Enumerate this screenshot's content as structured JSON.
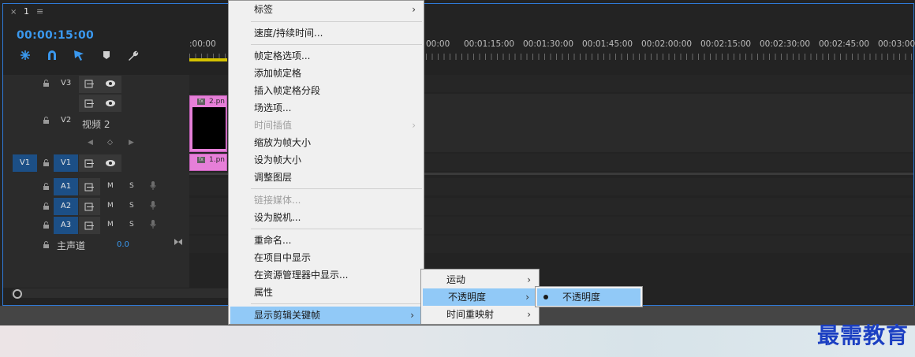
{
  "sequence": {
    "tab_label": "1",
    "close_glyph": "×",
    "menu_glyph": "≡",
    "timecode": "00:00:15:00"
  },
  "toolbar_icons": [
    "snap-icon",
    "magnet-icon",
    "linked-selection-icon",
    "marker-icon",
    "wrench-icon"
  ],
  "ruler": {
    "labels": [
      ":00:00",
      "00:00",
      "00:01:15:00",
      "00:01:30:00",
      "00:01:45:00",
      "00:02:00:00",
      "00:02:15:00",
      "00:02:30:00",
      "00:02:45:00",
      "00:03:00:0"
    ]
  },
  "tracks": {
    "v3": {
      "name": "V3"
    },
    "v2": {
      "name": "V2",
      "title": "视频 2"
    },
    "v1": {
      "source": "V1",
      "name": "V1"
    },
    "a1": {
      "name": "A1",
      "m": "M",
      "s": "S"
    },
    "a2": {
      "name": "A2",
      "m": "M",
      "s": "S"
    },
    "a3": {
      "name": "A3",
      "m": "M",
      "s": "S"
    },
    "master": {
      "title": "主声道",
      "value": "0.0"
    }
  },
  "clips": {
    "v2_clip": {
      "label": "2.pn",
      "fx": "fx"
    },
    "v1_clip": {
      "label": "1.pn",
      "fx": "fx"
    }
  },
  "context_menu": {
    "items": [
      {
        "label": "标签",
        "submenu": true
      },
      {
        "label": "速度/持续时间..."
      },
      {
        "label": "帧定格选项..."
      },
      {
        "label": "添加帧定格"
      },
      {
        "label": "插入帧定格分段"
      },
      {
        "label": "场选项..."
      },
      {
        "label": "时间插值",
        "submenu": true,
        "disabled": true
      },
      {
        "label": "缩放为帧大小"
      },
      {
        "label": "设为帧大小"
      },
      {
        "label": "调整图层"
      },
      {
        "label": "链接媒体...",
        "disabled": true
      },
      {
        "label": "设为脱机..."
      },
      {
        "label": "重命名..."
      },
      {
        "label": "在项目中显示"
      },
      {
        "label": "在资源管理器中显示..."
      },
      {
        "label": "属性"
      },
      {
        "label": "显示剪辑关键帧",
        "submenu": true,
        "highlighted": true
      }
    ]
  },
  "submenu": {
    "items": [
      {
        "label": "运动"
      },
      {
        "label": "不透明度",
        "highlighted": true
      },
      {
        "label": "时间重映射"
      }
    ]
  },
  "submenu2": {
    "items": [
      {
        "label": "不透明度",
        "checked": true
      }
    ]
  },
  "arrow_glyph": "›",
  "watermark": "最需教育",
  "colors": {
    "accent_blue": "#3a98ee",
    "track_target": "#1c4f86",
    "clip_pink": "#e67fd8",
    "menu_highlight": "#91c9f7",
    "watermark_blue": "#1b3fc2"
  }
}
